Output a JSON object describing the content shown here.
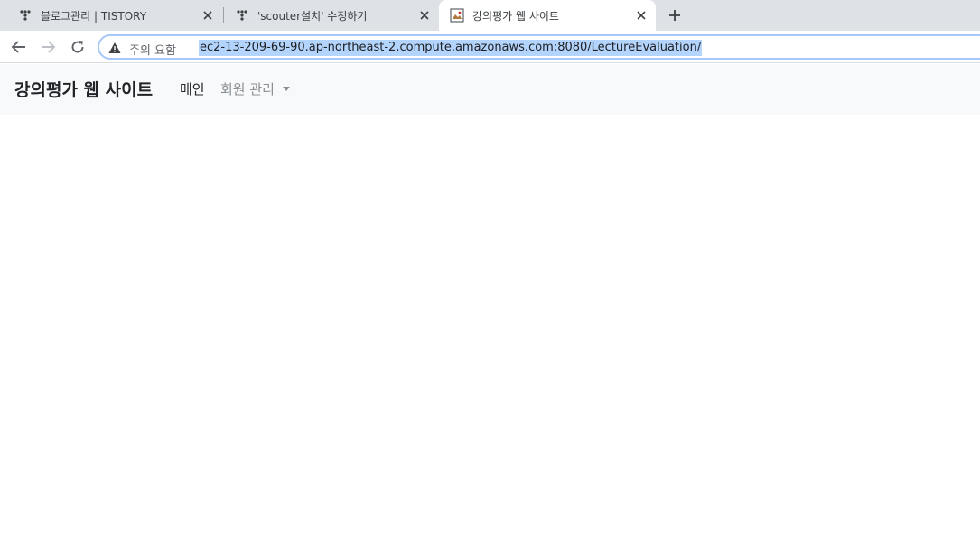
{
  "tabs": [
    {
      "title": "블로그관리 | TISTORY",
      "icon": "tistory-icon"
    },
    {
      "title": "'scouter설치' 수정하기",
      "icon": "tistory-icon"
    },
    {
      "title": "강의평가 웹 사이트",
      "icon": "page-image-icon"
    }
  ],
  "omnibox": {
    "security_text": "주의 요함",
    "url": "ec2-13-209-69-90.ap-northeast-2.compute.amazonaws.com:8080/LectureEvaluation/"
  },
  "navbar": {
    "brand": "강의평가 웹 사이트",
    "items": [
      {
        "label": "메인"
      },
      {
        "label": "회원 관리"
      }
    ]
  },
  "colors": {
    "tabstrip": "#dee1e6",
    "navbar_bg": "#f8f9fa",
    "url_highlight": "#b3d4fc",
    "muted_nav": "#8a8f94"
  }
}
